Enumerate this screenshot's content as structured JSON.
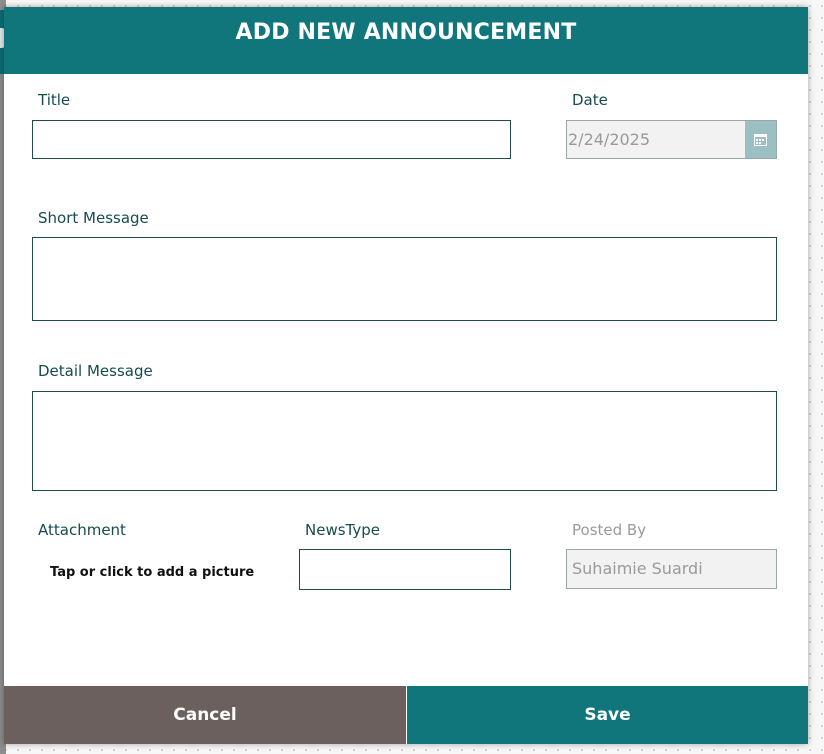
{
  "header": {
    "title": "ADD NEW ANNOUNCEMENT"
  },
  "form": {
    "title": {
      "label": "Title",
      "value": ""
    },
    "date": {
      "label": "Date",
      "value": "2/24/2025"
    },
    "short_message": {
      "label": "Short Message",
      "value": ""
    },
    "detail_message": {
      "label": "Detail Message",
      "value": ""
    },
    "attachment": {
      "label": "Attachment",
      "prompt": "Tap or click to add a picture"
    },
    "news_type": {
      "label": "NewsType",
      "value": ""
    },
    "posted_by": {
      "label": "Posted By",
      "value": "Suhaimie Suardi"
    }
  },
  "footer": {
    "cancel_label": "Cancel",
    "save_label": "Save"
  },
  "icons": {
    "date_picker": "calendar-icon"
  },
  "colors": {
    "header": "#10767b",
    "save": "#10767b",
    "cancel": "#6c605e",
    "label": "#164b4f"
  }
}
